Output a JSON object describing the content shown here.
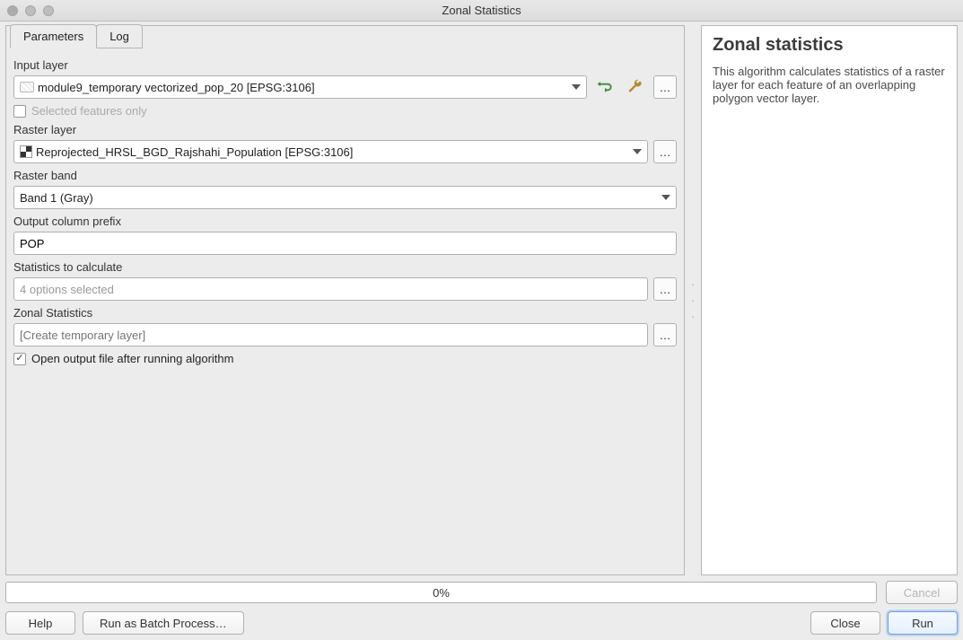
{
  "window": {
    "title": "Zonal Statistics"
  },
  "tabs": {
    "parameters": "Parameters",
    "log": "Log",
    "active": "parameters"
  },
  "fields": {
    "input_layer": {
      "label": "Input layer",
      "value": "module9_temporary vectorized_pop_20 [EPSG:3106]"
    },
    "selected_only": {
      "label": "Selected features only",
      "checked": false,
      "enabled": false
    },
    "raster_layer": {
      "label": "Raster layer",
      "value": "Reprojected_HRSL_BGD_Rajshahi_Population [EPSG:3106]"
    },
    "raster_band": {
      "label": "Raster band",
      "value": "Band 1 (Gray)"
    },
    "prefix": {
      "label": "Output column prefix",
      "value": "POP"
    },
    "stats": {
      "label": "Statistics to calculate",
      "value": "4 options selected"
    },
    "output": {
      "label": "Zonal Statistics",
      "placeholder": "[Create temporary layer]",
      "value": ""
    },
    "open_after": {
      "label": "Open output file after running algorithm",
      "checked": true
    }
  },
  "help": {
    "title": "Zonal statistics",
    "body": "This algorithm calculates statistics of a raster layer for each feature of an overlapping polygon vector layer."
  },
  "progress": {
    "text": "0%"
  },
  "buttons": {
    "cancel": "Cancel",
    "help": "Help",
    "batch": "Run as Batch Process…",
    "close": "Close",
    "run": "Run"
  }
}
